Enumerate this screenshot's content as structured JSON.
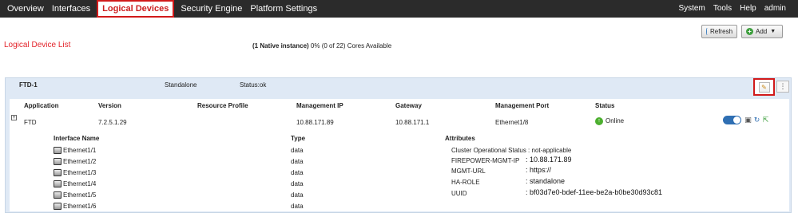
{
  "nav": {
    "tabs": [
      {
        "label": "Overview"
      },
      {
        "label": "Interfaces"
      },
      {
        "label": "Logical Devices",
        "active": true
      },
      {
        "label": "Security Engine"
      },
      {
        "label": "Platform Settings"
      }
    ],
    "right": [
      {
        "label": "System"
      },
      {
        "label": "Tools"
      },
      {
        "label": "Help"
      },
      {
        "label": "admin"
      }
    ]
  },
  "page": {
    "title": "Logical Device List",
    "cores_bold": "(1 Native instance)",
    "cores_text": " 0% (0 of 22) Cores Available"
  },
  "toolbar": {
    "refresh_label": "Refresh",
    "add_label": "Add"
  },
  "device": {
    "name": "FTD-1",
    "mode": "Standalone",
    "status": "Status:ok",
    "more_icon": "⋮",
    "columns": [
      "Application",
      "Version",
      "Resource Profile",
      "Management IP",
      "Gateway",
      "Management Port",
      "Status"
    ],
    "application": {
      "name": "FTD",
      "version": "7.2.5.1.29",
      "resource_profile": "",
      "management_ip": "10.88.171.89",
      "gateway": "10.88.171.1",
      "management_port": "Ethernet1/8",
      "status": "Online"
    },
    "interfaces_header": {
      "name": "Interface Name",
      "type": "Type"
    },
    "interfaces": [
      {
        "name": "Ethernet1/1",
        "type": "data"
      },
      {
        "name": "Ethernet1/2",
        "type": "data"
      },
      {
        "name": "Ethernet1/3",
        "type": "data"
      },
      {
        "name": "Ethernet1/4",
        "type": "data"
      },
      {
        "name": "Ethernet1/5",
        "type": "data"
      },
      {
        "name": "Ethernet1/6",
        "type": "data"
      }
    ],
    "attributes_header": "Attributes",
    "attributes": [
      {
        "label": "Cluster Operational Status : not-applicable",
        "value": ""
      },
      {
        "label": "FIREPOWER-MGMT-IP",
        "value": ": 10.88.171.89"
      },
      {
        "label": "MGMT-URL",
        "value": ": https://"
      },
      {
        "label": "HA-ROLE",
        "value": ": standalone"
      },
      {
        "label": "UUID",
        "value": ": bf03d7e0-bdef-11ee-be2a-b0be30d93c81"
      }
    ]
  },
  "colors": {
    "nav_bg": "#2b2b2b",
    "accent_red": "#e3242b",
    "panel_bg": "#dfe9f5",
    "online_green": "#4caf2f",
    "toggle_blue": "#2f6fb3"
  }
}
